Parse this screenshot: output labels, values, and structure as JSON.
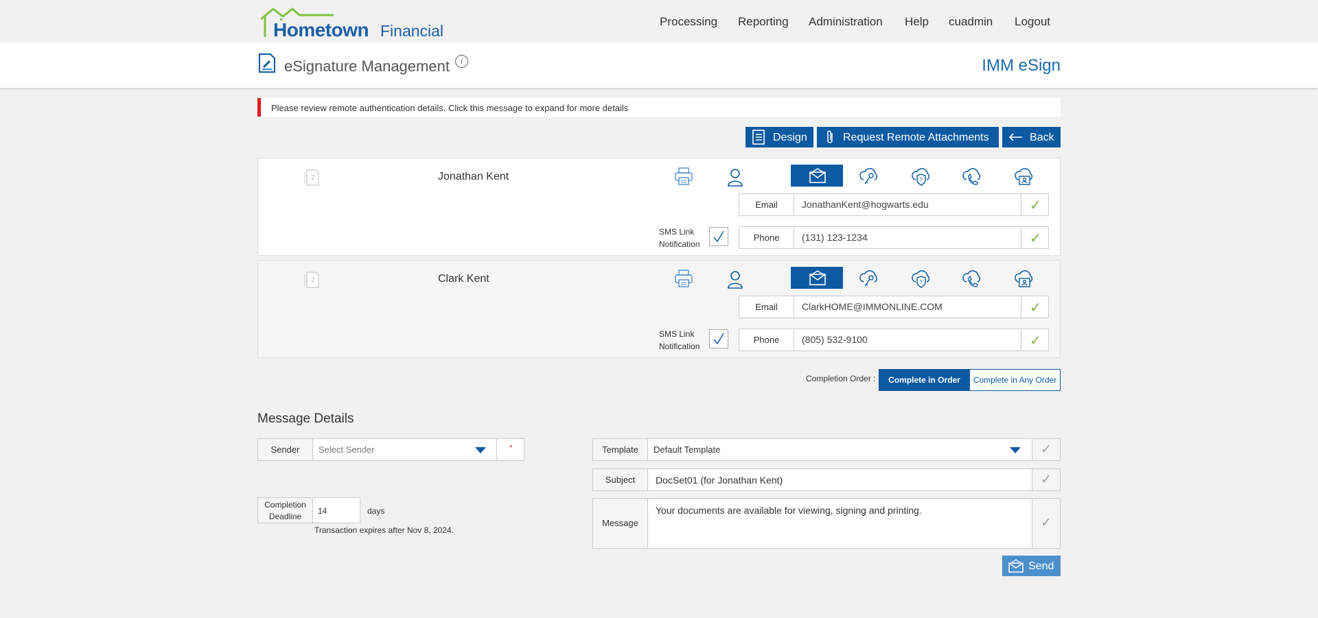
{
  "nav": {
    "logo_part1": "Hometown",
    "logo_part2": "Financial",
    "items": [
      "Processing",
      "Reporting",
      "Administration",
      "Help",
      "cuadmin",
      "Logout"
    ]
  },
  "header": {
    "title": "eSignature Management",
    "info": "i",
    "brand": "IMM eSign"
  },
  "alert": {
    "text": "Please review remote authentication details. Click this message to expand for more details"
  },
  "actions": {
    "design": "Design",
    "request": "Request Remote Attachments",
    "back": "Back"
  },
  "signers": [
    {
      "doc_count": "2",
      "name": "Jonathan Kent",
      "sms_label_1": "SMS Link",
      "sms_label_2": "Notification",
      "email_label": "Email",
      "email": "JonathanKent@hogwarts.edu",
      "phone_label": "Phone",
      "phone": "(131) 123-1234"
    },
    {
      "doc_count": "2",
      "name": "Clark Kent",
      "sms_label_1": "SMS Link",
      "sms_label_2": "Notification",
      "email_label": "Email",
      "email": "ClarkHOME@IMMONLINE.COM",
      "phone_label": "Phone",
      "phone": "(805) 532-9100"
    }
  ],
  "completion_order": {
    "label": "Completion Order :",
    "in_order": "Complete in Order",
    "any_order": "Complete in Any Order"
  },
  "message_details": {
    "title": "Message Details",
    "sender_label": "Sender",
    "sender_placeholder": "Select Sender",
    "required_marker": "*",
    "deadline_label_1": "Completion",
    "deadline_label_2": "Deadline",
    "deadline_value": "14",
    "deadline_unit": "days",
    "expires_text": "Transaction expires after Nov 8, 2024.",
    "template_label": "Template",
    "template_value": "Default Template",
    "subject_label": "Subject",
    "subject_value": "DocSet01 (for Jonathan Kent)",
    "message_label": "Message",
    "message_value": "Your documents are available for viewing, signing and printing.",
    "send": "Send"
  },
  "colors": {
    "brand_blue": "#0b5aa2",
    "check_green": "#7cb342",
    "alert_red": "#e31b23"
  }
}
